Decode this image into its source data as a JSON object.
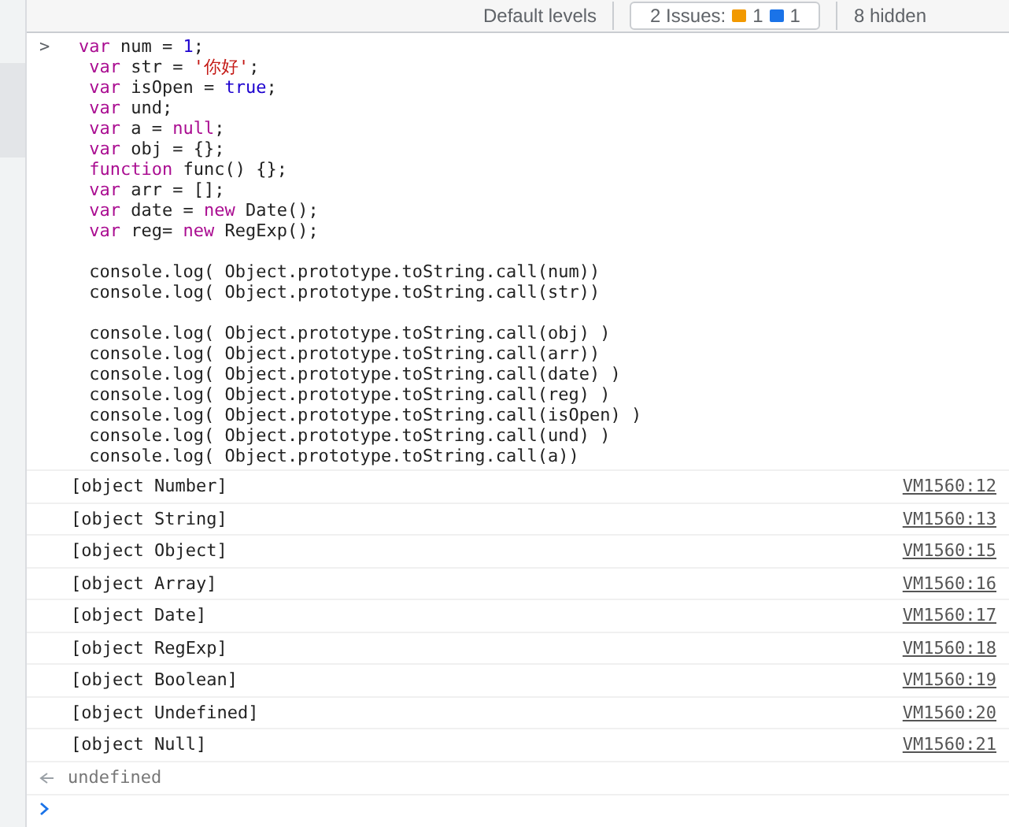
{
  "toolbar": {
    "levels": "Default levels",
    "issues": {
      "label": "2 Issues:",
      "warnings": "1",
      "infos": "1"
    },
    "hidden": "8 hidden"
  },
  "input": {
    "prompt": ">",
    "lines": [
      {
        "kind": "code",
        "tokens": [
          {
            "kind": "keyword",
            "text": "var"
          },
          {
            "kind": "plain",
            "text": " num = "
          },
          {
            "kind": "number",
            "text": "1"
          },
          {
            "kind": "plain",
            "text": ";"
          }
        ]
      },
      {
        "kind": "code",
        "tokens": [
          {
            "kind": "keyword",
            "text": "var"
          },
          {
            "kind": "plain",
            "text": " str = "
          },
          {
            "kind": "string",
            "text": "'你好'"
          },
          {
            "kind": "plain",
            "text": ";"
          }
        ]
      },
      {
        "kind": "code",
        "tokens": [
          {
            "kind": "keyword",
            "text": "var"
          },
          {
            "kind": "plain",
            "text": " isOpen = "
          },
          {
            "kind": "literal",
            "text": "true"
          },
          {
            "kind": "plain",
            "text": ";"
          }
        ]
      },
      {
        "kind": "code",
        "tokens": [
          {
            "kind": "keyword",
            "text": "var"
          },
          {
            "kind": "plain",
            "text": " und;"
          }
        ]
      },
      {
        "kind": "code",
        "tokens": [
          {
            "kind": "keyword",
            "text": "var"
          },
          {
            "kind": "plain",
            "text": " a = "
          },
          {
            "kind": "keyword",
            "text": "null"
          },
          {
            "kind": "plain",
            "text": ";"
          }
        ]
      },
      {
        "kind": "code",
        "tokens": [
          {
            "kind": "keyword",
            "text": "var"
          },
          {
            "kind": "plain",
            "text": " obj = {};"
          }
        ]
      },
      {
        "kind": "code",
        "tokens": [
          {
            "kind": "keyword",
            "text": "function"
          },
          {
            "kind": "plain",
            "text": " func() {};"
          }
        ]
      },
      {
        "kind": "code",
        "tokens": [
          {
            "kind": "keyword",
            "text": "var"
          },
          {
            "kind": "plain",
            "text": " arr = [];"
          }
        ]
      },
      {
        "kind": "code",
        "tokens": [
          {
            "kind": "keyword",
            "text": "var"
          },
          {
            "kind": "plain",
            "text": " date = "
          },
          {
            "kind": "keyword",
            "text": "new"
          },
          {
            "kind": "plain",
            "text": " Date();"
          }
        ]
      },
      {
        "kind": "code",
        "tokens": [
          {
            "kind": "keyword",
            "text": "var"
          },
          {
            "kind": "plain",
            "text": " reg= "
          },
          {
            "kind": "keyword",
            "text": "new"
          },
          {
            "kind": "plain",
            "text": " RegExp();"
          }
        ]
      },
      {
        "kind": "blank"
      },
      {
        "kind": "code",
        "tokens": [
          {
            "kind": "plain",
            "text": "console.log( Object.prototype.toString.call(num))"
          }
        ]
      },
      {
        "kind": "code",
        "tokens": [
          {
            "kind": "plain",
            "text": "console.log( Object.prototype.toString.call(str))"
          }
        ]
      },
      {
        "kind": "blank"
      },
      {
        "kind": "code",
        "tokens": [
          {
            "kind": "plain",
            "text": "console.log( Object.prototype.toString.call(obj) )"
          }
        ]
      },
      {
        "kind": "code",
        "tokens": [
          {
            "kind": "plain",
            "text": "console.log( Object.prototype.toString.call(arr))"
          }
        ]
      },
      {
        "kind": "code",
        "tokens": [
          {
            "kind": "plain",
            "text": "console.log( Object.prototype.toString.call(date) )"
          }
        ]
      },
      {
        "kind": "code",
        "tokens": [
          {
            "kind": "plain",
            "text": "console.log( Object.prototype.toString.call(reg) )"
          }
        ]
      },
      {
        "kind": "code",
        "tokens": [
          {
            "kind": "plain",
            "text": "console.log( Object.prototype.toString.call(isOpen) )"
          }
        ]
      },
      {
        "kind": "code",
        "tokens": [
          {
            "kind": "plain",
            "text": "console.log( Object.prototype.toString.call(und) )"
          }
        ]
      },
      {
        "kind": "code",
        "tokens": [
          {
            "kind": "plain",
            "text": "console.log( Object.prototype.toString.call(a))"
          }
        ]
      }
    ]
  },
  "output": [
    {
      "text": "[object Number]",
      "source": "VM1560:12"
    },
    {
      "text": "[object String]",
      "source": "VM1560:13"
    },
    {
      "text": "[object Object]",
      "source": "VM1560:15"
    },
    {
      "text": "[object Array]",
      "source": "VM1560:16"
    },
    {
      "text": "[object Date]",
      "source": "VM1560:17"
    },
    {
      "text": "[object RegExp]",
      "source": "VM1560:18"
    },
    {
      "text": "[object Boolean]",
      "source": "VM1560:19"
    },
    {
      "text": "[object Undefined]",
      "source": "VM1560:20"
    },
    {
      "text": "[object Null]",
      "source": "VM1560:21"
    }
  ],
  "result": "undefined"
}
